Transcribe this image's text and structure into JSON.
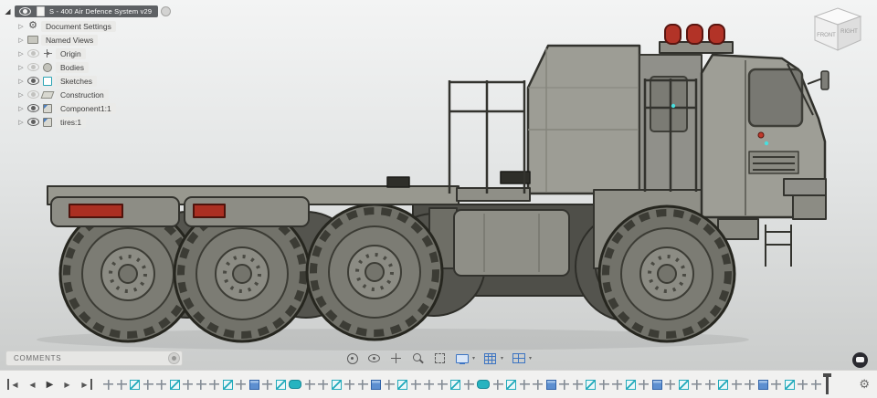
{
  "browser": {
    "root": {
      "label": "S - 400 Air Defence System v29"
    },
    "items": [
      {
        "label": "Document Settings",
        "icon": "gear",
        "eye": false
      },
      {
        "label": "Named Views",
        "icon": "folder",
        "eye": false
      },
      {
        "label": "Origin",
        "icon": "origin",
        "eye": "off"
      },
      {
        "label": "Bodies",
        "icon": "bodies",
        "eye": "off"
      },
      {
        "label": "Sketches",
        "icon": "sketches",
        "eye": "on"
      },
      {
        "label": "Construction",
        "icon": "construction",
        "eye": "off"
      },
      {
        "label": "Component1:1",
        "icon": "component",
        "eye": "on"
      },
      {
        "label": "tires:1",
        "icon": "component",
        "eye": "on"
      }
    ]
  },
  "viewcube": {
    "front": "FRONT",
    "right": "RIGHT"
  },
  "comments": {
    "label": "COMMENTS"
  },
  "navbar": {
    "items": [
      {
        "name": "orbit",
        "caret": false
      },
      {
        "name": "look-at",
        "caret": false
      },
      {
        "name": "pan",
        "caret": false
      },
      {
        "name": "zoom",
        "caret": false
      },
      {
        "name": "fit",
        "caret": false
      },
      {
        "name": "display-settings",
        "caret": true
      },
      {
        "name": "grid-and-snaps",
        "caret": true
      },
      {
        "name": "viewports",
        "caret": true
      }
    ]
  },
  "timeline": {
    "playback": [
      "skip-start",
      "step-back",
      "play",
      "step-forward",
      "skip-end"
    ],
    "features": [
      "move",
      "move",
      "sketch",
      "move",
      "move",
      "sketch",
      "move",
      "move",
      "move",
      "sketch",
      "move",
      "box",
      "move",
      "sketch",
      "pill",
      "move",
      "move",
      "sketch",
      "move",
      "move",
      "box",
      "move",
      "sketch",
      "move",
      "move",
      "move",
      "sketch",
      "move",
      "pill",
      "move",
      "sketch",
      "move",
      "move",
      "box",
      "move",
      "move",
      "sketch",
      "move",
      "move",
      "sketch",
      "move",
      "box",
      "move",
      "sketch",
      "move",
      "move",
      "sketch",
      "move",
      "move",
      "box",
      "move",
      "sketch",
      "move",
      "move"
    ]
  },
  "icons": {
    "expanded": "◢",
    "collapsed": "▷",
    "caret": "▾"
  },
  "colors": {
    "beacon_red": "#b23327",
    "reflector_red": "#ab2f22",
    "sketch_cyan": "#49dede",
    "accent_blue": "#3c74c2",
    "body_gray": "#9b9b93"
  }
}
